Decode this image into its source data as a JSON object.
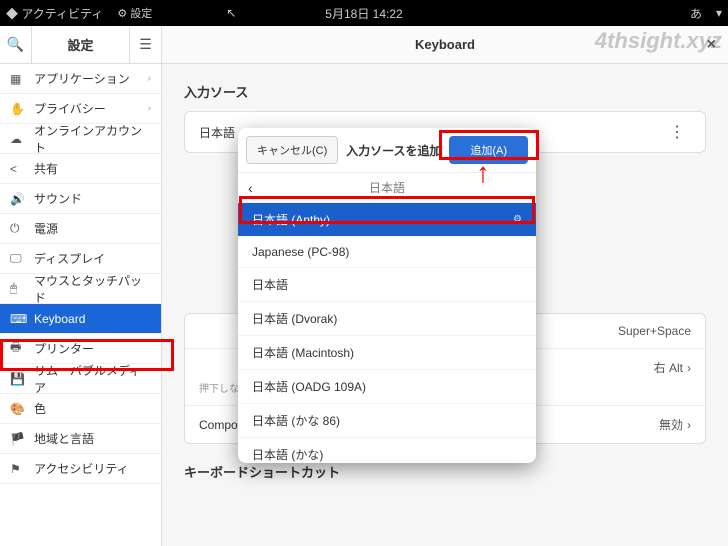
{
  "topbar": {
    "activities": "アクティビティ",
    "settings": "設定",
    "datetime": "5月18日  14:22",
    "ime": "あ"
  },
  "watermark": "4thsight.xyz",
  "sidebar": {
    "title": "設定",
    "items": [
      {
        "icon": "▦",
        "label": "アプリケーション",
        "chev": true
      },
      {
        "icon": "✋",
        "label": "プライバシー",
        "chev": true
      },
      {
        "icon": "☁",
        "label": "オンラインアカウント"
      },
      {
        "icon": "<",
        "label": "共有"
      },
      {
        "icon": "🔊",
        "label": "サウンド"
      },
      {
        "icon": "⏻",
        "label": "電源"
      },
      {
        "icon": "🖵",
        "label": "ディスプレイ"
      },
      {
        "icon": "🖱",
        "label": "マウスとタッチパッド"
      },
      {
        "icon": "⌨",
        "label": "Keyboard",
        "selected": true
      },
      {
        "icon": "🖶",
        "label": "プリンター"
      },
      {
        "icon": "💾",
        "label": "リムーバブルメディア"
      },
      {
        "icon": "🎨",
        "label": "色"
      },
      {
        "icon": "🏴",
        "label": "地域と言語"
      },
      {
        "icon": "⚑",
        "label": "アクセシビリティ"
      }
    ]
  },
  "main": {
    "title": "Keyboard",
    "section1": "入力ソース",
    "row1_label": "日本語",
    "section2_row1_label": "",
    "row_super": "Super+Space",
    "row_alt_label": "",
    "row_alt_val": "右 Alt",
    "row_alt_sub": "押下しながらキー入力すると別の文字を入力できます",
    "row_compose": "Compose キー",
    "row_compose_val": "無効",
    "section3": "キーボードショートカット"
  },
  "dialog": {
    "cancel": "キャンセル(C)",
    "title": "入力ソースを追加",
    "add": "追加(A)",
    "subhead": "日本語",
    "items": [
      {
        "label": "日本語 (Anthy)",
        "selected": true,
        "badge": "⚙"
      },
      {
        "label": "Japanese (PC-98)"
      },
      {
        "label": "日本語"
      },
      {
        "label": "日本語 (Dvorak)"
      },
      {
        "label": "日本語 (Macintosh)"
      },
      {
        "label": "日本語 (OADG 109A)"
      },
      {
        "label": "日本語 (かな 86)"
      },
      {
        "label": "日本語 (かな)"
      }
    ]
  }
}
